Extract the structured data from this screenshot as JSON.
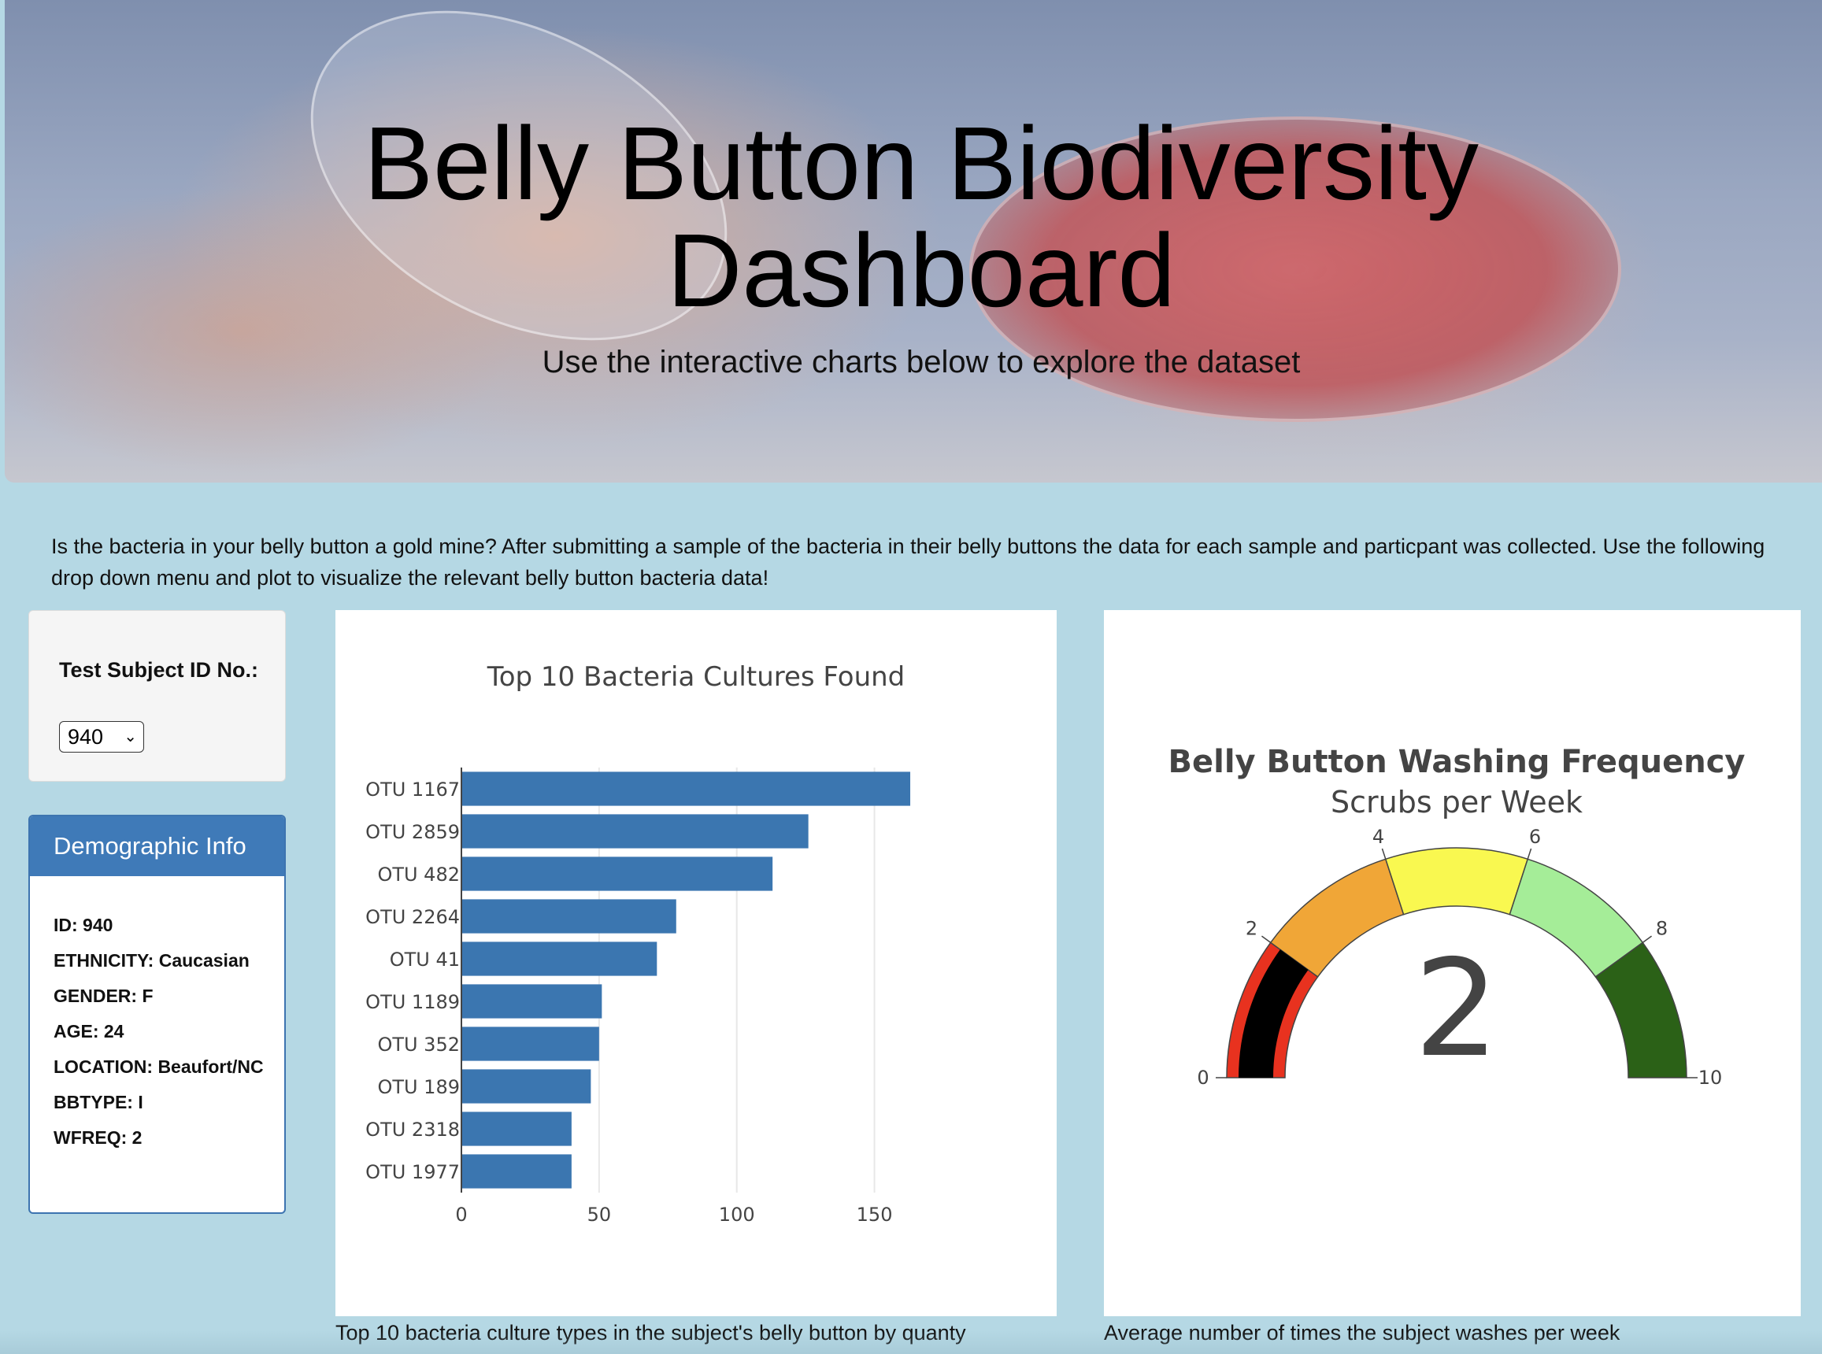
{
  "hero": {
    "title_line1": "Belly Button Biodiversity",
    "title_line2": "Dashboard",
    "subtitle": "Use the interactive charts below to explore the dataset"
  },
  "intro": "Is the bacteria in your belly button a gold mine? After submitting a sample of the bacteria in their belly buttons the data for each sample and particpant was collected. Use the following drop down menu and plot to visualize the relevant belly button bacteria data!",
  "selector": {
    "label": "Test Subject ID No.:",
    "selected": "940"
  },
  "demographics": {
    "header": "Demographic Info",
    "rows": [
      "ID: 940",
      "ETHNICITY: Caucasian",
      "GENDER: F",
      "AGE: 24",
      "LOCATION: Beaufort/NC",
      "BBTYPE: I",
      "WFREQ: 2"
    ]
  },
  "captions": {
    "bar": "Top 10 bacteria culture types in the subject's belly button by quanty",
    "gauge": "Average number of times the subject washes per week"
  },
  "chart_data": [
    {
      "type": "bar",
      "orientation": "horizontal",
      "title": "Top 10 Bacteria Cultures Found",
      "categories": [
        "OTU 1167",
        "OTU 2859",
        "OTU 482",
        "OTU 2264",
        "OTU 41",
        "OTU 1189",
        "OTU 352",
        "OTU 189",
        "OTU 2318",
        "OTU 1977"
      ],
      "values": [
        163,
        126,
        113,
        78,
        71,
        51,
        50,
        47,
        40,
        40
      ],
      "xlim": [
        0,
        175
      ],
      "xticks": [
        0,
        50,
        100,
        150
      ],
      "grid": true,
      "color": "#3b76b0"
    },
    {
      "type": "gauge",
      "title": "Belly Button Washing Frequency",
      "subtitle": "Scrubs per Week",
      "value": 2,
      "range": [
        0,
        10
      ],
      "ticks": [
        0,
        2,
        4,
        6,
        8,
        10
      ],
      "steps": [
        {
          "range": [
            0,
            2
          ],
          "color": "#e8321f"
        },
        {
          "range": [
            2,
            4
          ],
          "color": "#f0a637"
        },
        {
          "range": [
            4,
            6
          ],
          "color": "#f9f850"
        },
        {
          "range": [
            6,
            8
          ],
          "color": "#a5ed98"
        },
        {
          "range": [
            8,
            10
          ],
          "color": "#2b6117"
        }
      ],
      "bar_color": "#000000"
    }
  ]
}
